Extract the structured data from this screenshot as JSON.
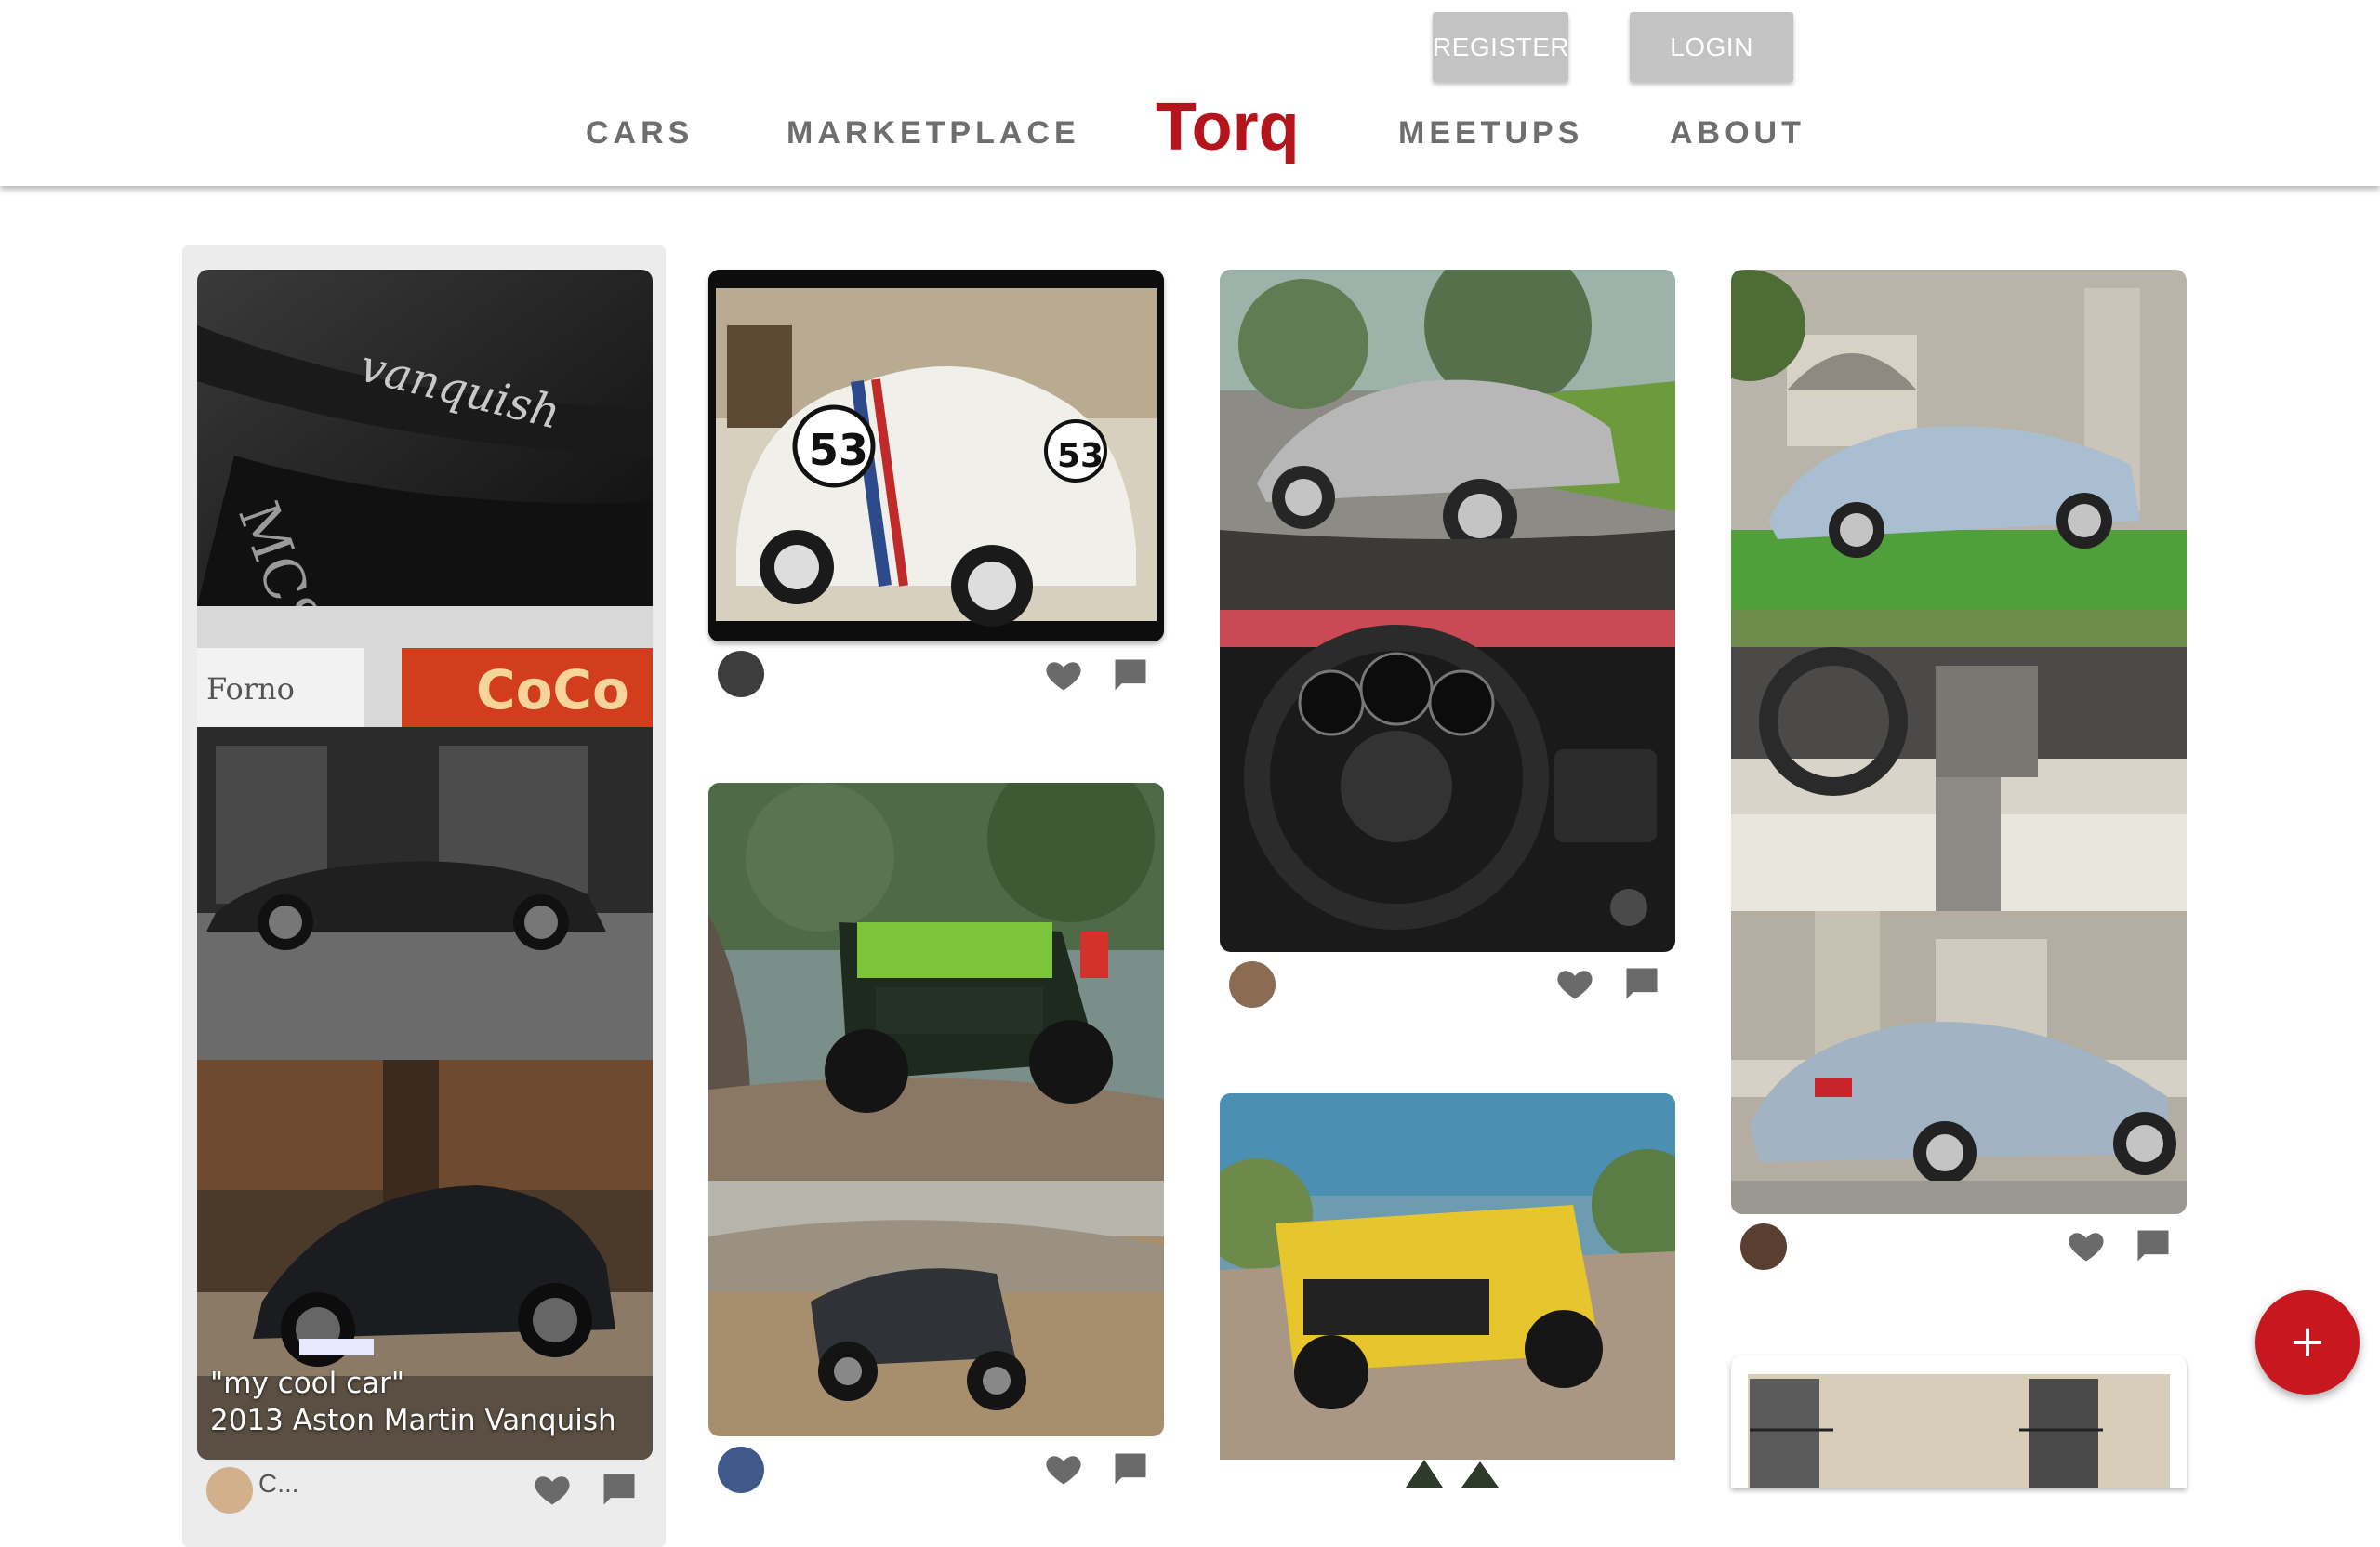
{
  "header": {
    "register_label": "REGISTER",
    "login_label": "LOGIN",
    "nav": {
      "cars": "CARS",
      "marketplace": "MARKETPLACE",
      "brand": "Torq",
      "meetups": "MEETUPS",
      "about": "ABOUT"
    }
  },
  "feed": {
    "featured_caption_line1": "\"my cool car\"",
    "featured_caption_line2": "2013 Aston Martin Vanquish",
    "featured_user_partial": "C..."
  },
  "icons": {
    "like": "heart-icon",
    "comment": "comment-icon",
    "add": "plus-icon"
  },
  "colors": {
    "brand": "#b3151d",
    "fab": "#c8181f",
    "nav_text": "#6e6e6e",
    "auth_button": "#c3c3c3"
  },
  "fab_label": "+"
}
